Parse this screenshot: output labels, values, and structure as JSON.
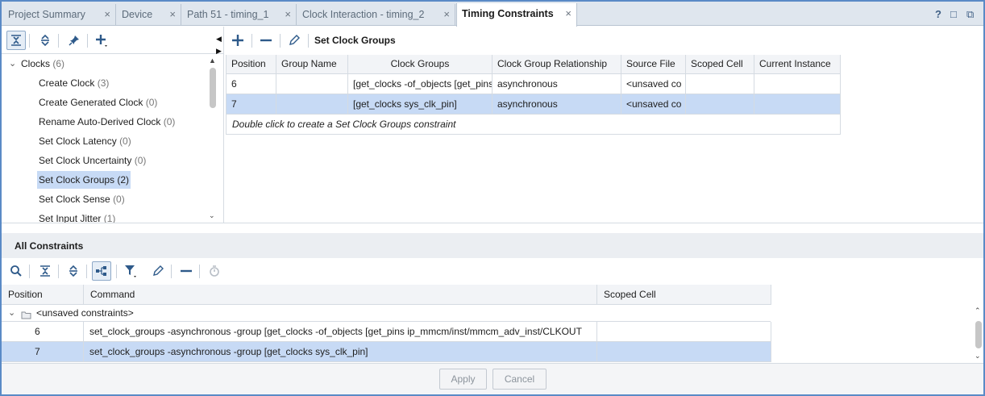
{
  "tabs": [
    {
      "label": "Project Summary"
    },
    {
      "label": "Device"
    },
    {
      "label": "Path 51 - timing_1"
    },
    {
      "label": "Clock Interaction - timing_2"
    },
    {
      "label": "Timing Constraints",
      "active": true
    }
  ],
  "tab_close_glyph": "×",
  "window_controls": {
    "help": "?",
    "restore": "□",
    "float": "⧉"
  },
  "icons": {
    "collapse_all": "collapse-all-icon",
    "expand_all": "expand-all-icon",
    "pin": "pin-icon",
    "add": "plus-icon",
    "remove": "minus-icon",
    "edit": "pencil-icon",
    "search": "search-icon",
    "hierarchy": "hierarchy-icon",
    "filter": "filter-icon",
    "timer": "stopwatch-icon",
    "folder": "folder-icon"
  },
  "constraint_toolbar": {
    "title": "Set Clock Groups"
  },
  "tree": {
    "root": {
      "label": "Clocks",
      "count": "(6)"
    },
    "items": [
      {
        "label": "Create Clock",
        "count": "(3)"
      },
      {
        "label": "Create Generated Clock",
        "count": "(0)"
      },
      {
        "label": "Rename Auto-Derived Clock",
        "count": "(0)"
      },
      {
        "label": "Set Clock Latency",
        "count": "(0)"
      },
      {
        "label": "Set Clock Uncertainty",
        "count": "(0)"
      },
      {
        "label": "Set Clock Groups",
        "count": "(2)",
        "selected": true
      },
      {
        "label": "Set Clock Sense",
        "count": "(0)"
      },
      {
        "label": "Set Input Jitter",
        "count": "(1)"
      }
    ]
  },
  "top_table": {
    "columns": [
      "Position",
      "Group Name",
      "Clock Groups",
      "Clock Group Relationship",
      "Source File",
      "Scoped Cell",
      "Current Instance"
    ],
    "rows": [
      {
        "position": "6",
        "group_name": "",
        "clock_groups": "[get_clocks -of_objects [get_pins",
        "relationship": "asynchronous",
        "source_file": "<unsaved co",
        "scoped_cell": "",
        "current_instance": ""
      },
      {
        "position": "7",
        "group_name": "",
        "clock_groups": "[get_clocks sys_clk_pin]",
        "relationship": "asynchronous",
        "source_file": "<unsaved co",
        "scoped_cell": "",
        "current_instance": "",
        "selected": true
      }
    ],
    "hint": "Double click to create a Set Clock Groups constraint"
  },
  "all_constraints": {
    "title": "All Constraints",
    "columns": [
      "Position",
      "Command",
      "Scoped Cell"
    ],
    "group_label": "<unsaved constraints>",
    "rows": [
      {
        "position": "6",
        "command": "set_clock_groups -asynchronous -group [get_clocks -of_objects [get_pins ip_mmcm/inst/mmcm_adv_inst/CLKOUT",
        "scoped_cell": ""
      },
      {
        "position": "7",
        "command": "set_clock_groups -asynchronous -group [get_clocks sys_clk_pin]",
        "scoped_cell": "",
        "selected": true
      }
    ]
  },
  "footer": {
    "apply_label": "Apply",
    "cancel_label": "Cancel"
  },
  "colors": {
    "selection": "#c7daf5",
    "accent": "#2e5a8a",
    "frame": "#5a8ac6"
  }
}
